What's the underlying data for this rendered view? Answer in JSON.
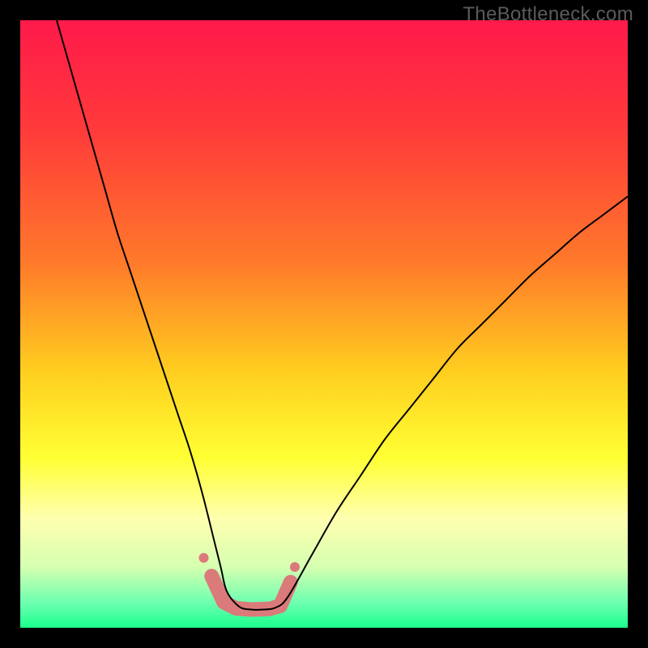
{
  "watermark": "TheBottleneck.com",
  "chart_data": {
    "type": "line",
    "title": "",
    "xlabel": "",
    "ylabel": "",
    "xlim": [
      0,
      100
    ],
    "ylim": [
      0,
      100
    ],
    "background_gradient_stops": [
      {
        "offset": 0.0,
        "color": "#ff1a4b"
      },
      {
        "offset": 0.18,
        "color": "#ff3a3a"
      },
      {
        "offset": 0.4,
        "color": "#ff7a2a"
      },
      {
        "offset": 0.58,
        "color": "#ffcf1f"
      },
      {
        "offset": 0.72,
        "color": "#ffff33"
      },
      {
        "offset": 0.82,
        "color": "#ffffb0"
      },
      {
        "offset": 0.9,
        "color": "#d6ffb0"
      },
      {
        "offset": 0.96,
        "color": "#6bffb0"
      },
      {
        "offset": 1.0,
        "color": "#1aff8c"
      }
    ],
    "series": [
      {
        "name": "bottleneck-curve",
        "color": "#000000",
        "stroke_width": 2,
        "x": [
          6,
          8,
          10,
          12,
          14,
          16,
          18,
          20,
          22,
          24,
          26,
          28,
          30,
          32,
          33,
          34,
          36,
          38,
          40,
          42,
          44,
          48,
          52,
          56,
          60,
          64,
          68,
          72,
          76,
          80,
          84,
          88,
          92,
          96,
          100
        ],
        "y": [
          100,
          93,
          86,
          79,
          72,
          65,
          59,
          53,
          47,
          41,
          35,
          29,
          22,
          14,
          10,
          6,
          3.5,
          3,
          3,
          3.3,
          5,
          12,
          19,
          25,
          31,
          36,
          41,
          46,
          50,
          54,
          58,
          61.5,
          65,
          68,
          71
        ]
      },
      {
        "name": "bottom-marker-shape",
        "color": "#db7a7a",
        "stroke_width": 18,
        "linecap": "round",
        "x": [
          31.5,
          33.5,
          35.5,
          38,
          41,
          42.8,
          44.5
        ],
        "y": [
          8.5,
          4.2,
          3.2,
          3.0,
          3.1,
          3.6,
          7.5
        ]
      }
    ],
    "lone_markers": [
      {
        "x": 30.2,
        "y": 11.5,
        "r": 6,
        "color": "#db7a7a"
      },
      {
        "x": 45.2,
        "y": 10.0,
        "r": 6,
        "color": "#db7a7a"
      }
    ]
  }
}
